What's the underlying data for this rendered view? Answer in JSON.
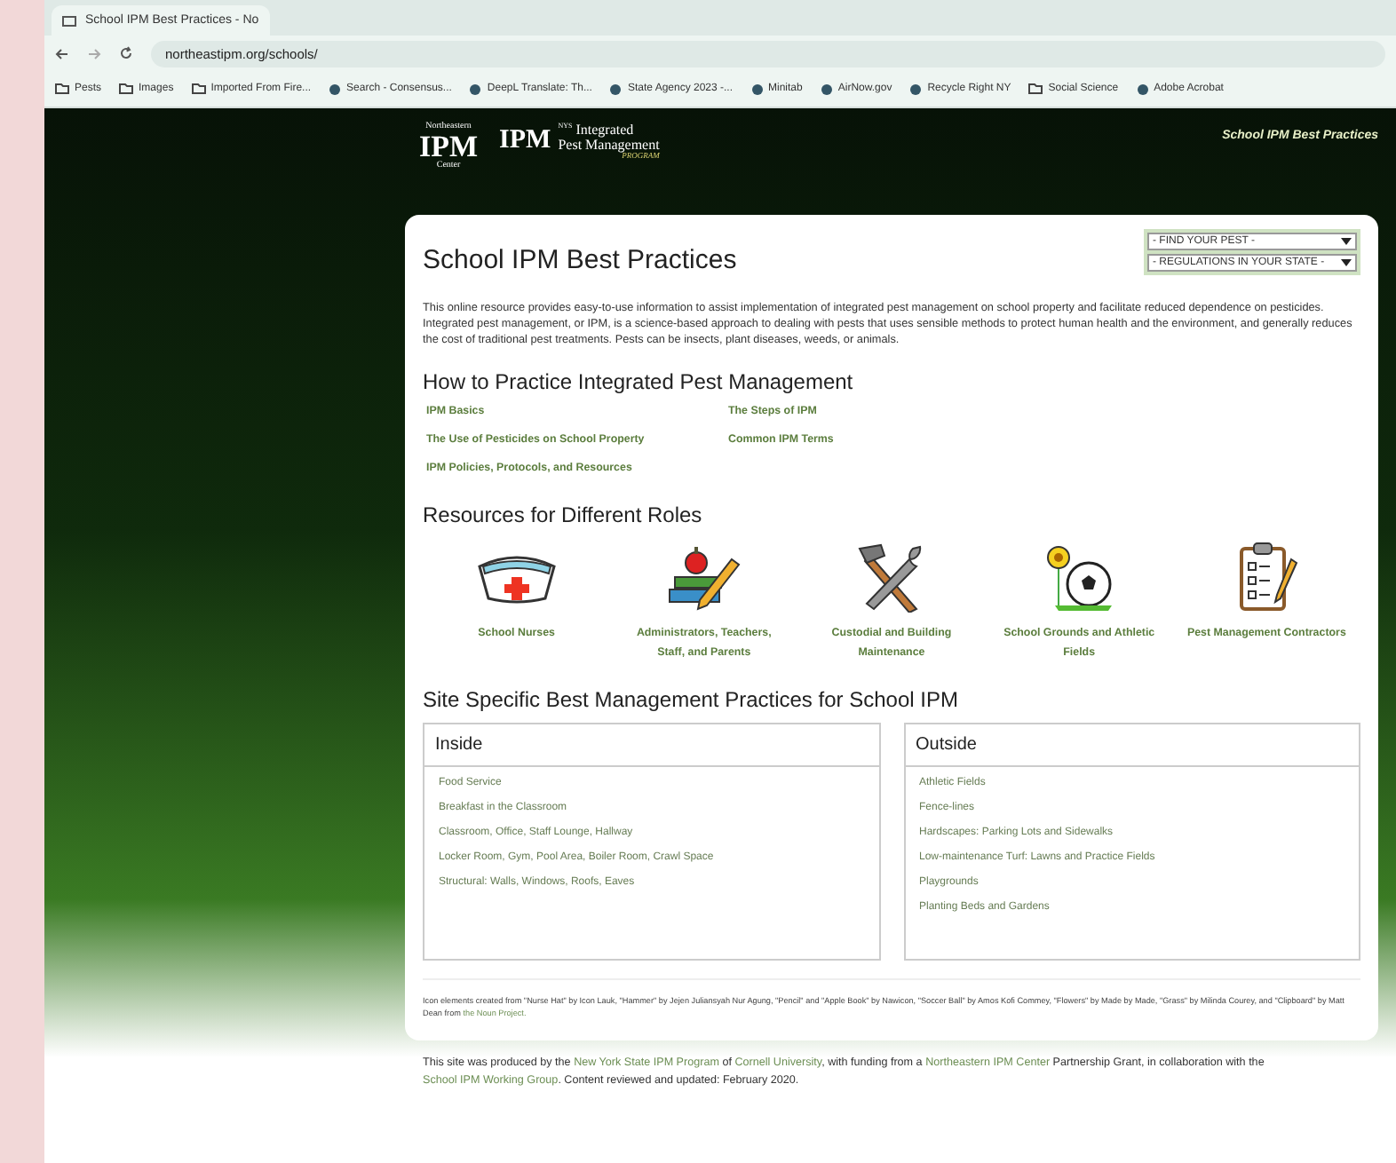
{
  "browser": {
    "tab_title": "School IPM Best Practices - No",
    "address": "northeastipm.org/schools/",
    "bookmarks": [
      {
        "label": "Pests",
        "kind": "folder"
      },
      {
        "label": "Images",
        "kind": "folder"
      },
      {
        "label": "Imported From Fire...",
        "kind": "folder"
      },
      {
        "label": "Search - Consensus...",
        "kind": "site"
      },
      {
        "label": "DeepL Translate: Th...",
        "kind": "site"
      },
      {
        "label": "State Agency 2023 -...",
        "kind": "site"
      },
      {
        "label": "Minitab",
        "kind": "site"
      },
      {
        "label": "AirNow.gov",
        "kind": "site"
      },
      {
        "label": "Recycle Right NY",
        "kind": "site"
      },
      {
        "label": "Social Science",
        "kind": "folder"
      },
      {
        "label": "Adobe Acrobat",
        "kind": "site"
      }
    ]
  },
  "header": {
    "logo_left": {
      "top": "Northeastern",
      "main": "IPM",
      "bottom": "Center"
    },
    "logo_right": {
      "mark": "IPM",
      "state": "NYS",
      "line1": "Integrated",
      "line2": "Pest Management",
      "line3": "PROGRAM"
    },
    "site_title": "School IPM Best Practices"
  },
  "page": {
    "title": "School IPM Best Practices",
    "dropdowns": [
      "- FIND YOUR PEST -",
      "- REGULATIONS IN YOUR STATE -"
    ],
    "intro": "This online resource provides easy-to-use information to assist implementation of integrated pest management on school property and facilitate reduced dependence on pesticides. Integrated pest management, or IPM, is a science-based approach to dealing with pests that uses sensible methods to protect human health and the environment, and generally reduces the cost of traditional pest treatments. Pests can be insects, plant diseases, weeds, or animals.",
    "practice": {
      "heading": "How to Practice Integrated Pest Management",
      "links": [
        "IPM Basics",
        "The Steps of IPM",
        "The Use of Pesticides on School Property",
        "Common IPM Terms",
        "IPM Policies, Protocols, and Resources"
      ]
    },
    "roles": {
      "heading": "Resources for Different Roles",
      "items": [
        {
          "kind": "nurse",
          "label": "School Nurses"
        },
        {
          "kind": "teacher",
          "label": "Administrators, Teachers, Staff, and Parents"
        },
        {
          "kind": "tools",
          "label": "Custodial and Building Maintenance"
        },
        {
          "kind": "grounds",
          "label": "School Grounds and Athletic Fields"
        },
        {
          "kind": "clipboard",
          "label": "Pest Management Contractors"
        }
      ]
    },
    "sites": {
      "heading": "Site Specific Best Management Practices for School IPM",
      "panels": [
        {
          "title": "Inside",
          "links": [
            "Food Service",
            "Breakfast in the Classroom",
            "Classroom, Office, Staff Lounge, Hallway",
            "Locker Room, Gym, Pool Area, Boiler Room, Crawl Space",
            "Structural: Walls, Windows, Roofs, Eaves"
          ]
        },
        {
          "title": "Outside",
          "links": [
            "Athletic Fields",
            "Fence-lines",
            "Hardscapes: Parking Lots and Sidewalks",
            "Low-maintenance Turf: Lawns and Practice Fields",
            "Playgrounds",
            "Planting Beds and Gardens"
          ]
        }
      ]
    },
    "credits": [
      {
        "text": "Icon elements created from \"Nurse Hat\" by Icon Lauk, \"Hammer\" by Jejen Juliansyah Nur Agung, \"Pencil\" and \"Apple Book\" by Nawicon, \"Soccer Ball\" by Amos Kofi Commey, \"Flowers\" by Made by Made, \"Grass\" by Milinda Courey, and \"Clipboard\" by Matt Dean from ",
        "link": false
      },
      {
        "text": "the Noun Project.",
        "link": true
      }
    ]
  },
  "footer": [
    {
      "text": "This site was produced by the ",
      "link": false
    },
    {
      "text": "New York State IPM Program",
      "link": true
    },
    {
      "text": " of ",
      "link": false
    },
    {
      "text": "Cornell University",
      "link": true
    },
    {
      "text": ", with funding from a ",
      "link": false
    },
    {
      "text": "Northeastern IPM Center",
      "link": true
    },
    {
      "text": " Partnership Grant, in collaboration with the ",
      "link": false
    },
    {
      "text": "School IPM Working Group",
      "link": true
    },
    {
      "text": ". Content reviewed and updated: February 2020.",
      "link": false
    }
  ]
}
